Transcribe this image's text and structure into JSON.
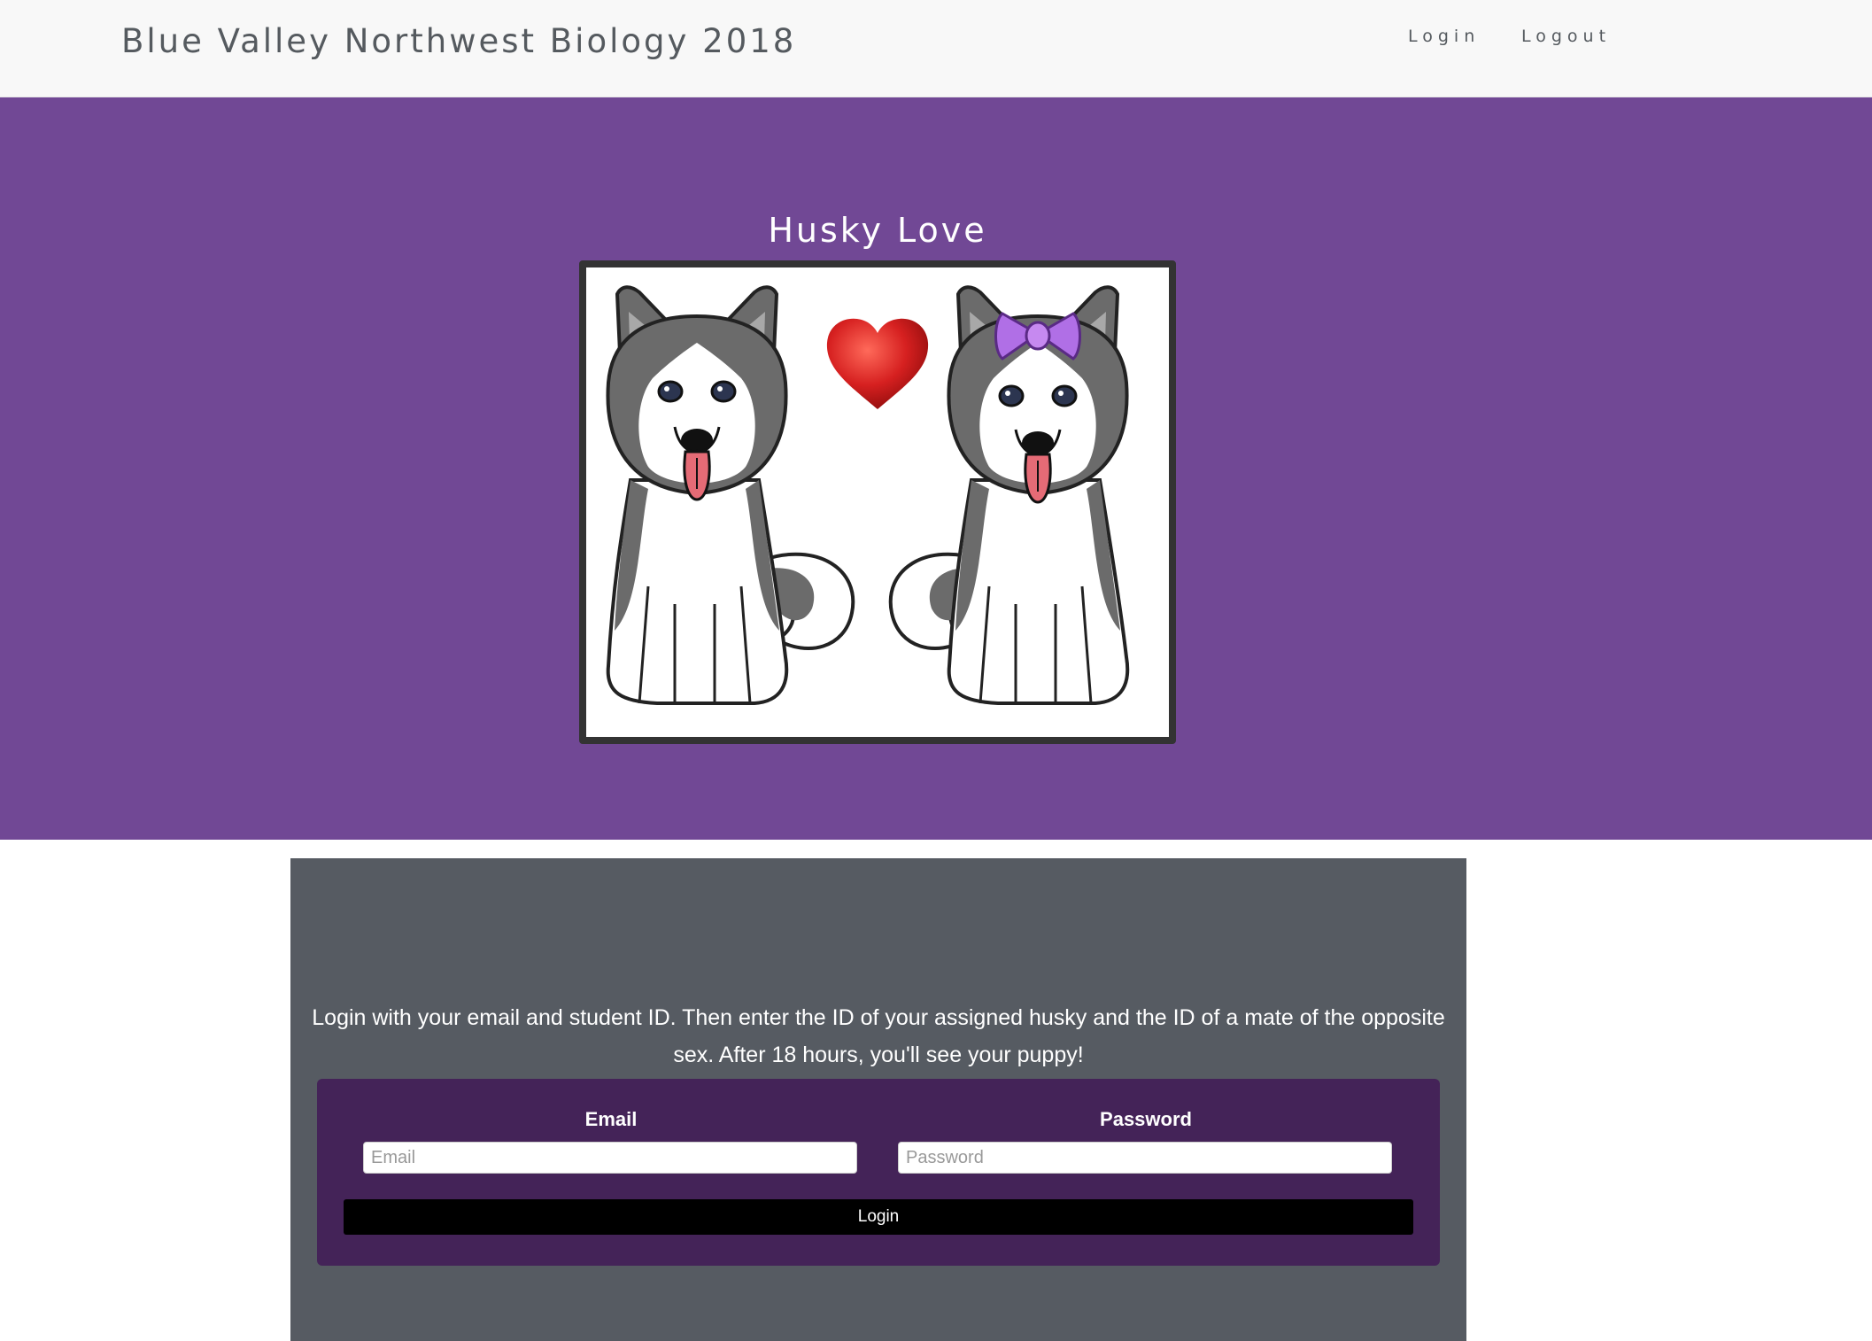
{
  "navbar": {
    "brand": "Blue Valley Northwest Biology 2018",
    "links": [
      "Login",
      "Logout"
    ]
  },
  "hero": {
    "title": "Husky Love",
    "image": {
      "description_icon": "husky-love-illustration",
      "colors": {
        "background": "#714895",
        "heart": "#d62020",
        "bow": "#b06fe6"
      }
    }
  },
  "panel": {
    "instructions": "Login with your email and student ID. Then enter the ID of your assigned husky and the ID of a mate of the opposite sex. After 18 hours, you'll see your puppy!",
    "form": {
      "email_label": "Email",
      "email_placeholder": "Email",
      "email_value": "",
      "password_label": "Password",
      "password_placeholder": "Password",
      "password_value": "",
      "submit_label": "Login"
    }
  },
  "colors": {
    "navbar_bg": "#f8f8f8",
    "hero_bg": "#714895",
    "panel_bg": "#565b62",
    "form_bg": "#442358",
    "button_bg": "#000000"
  }
}
